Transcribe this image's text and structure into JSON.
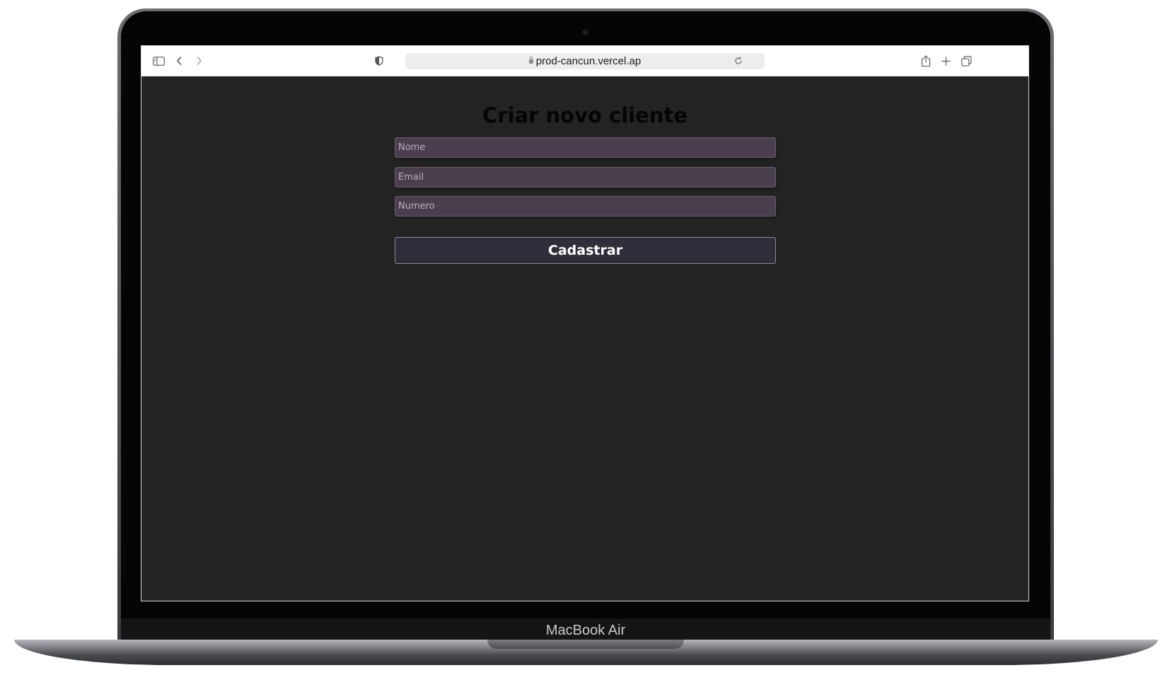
{
  "device": {
    "brand_label": "MacBook Air"
  },
  "browser": {
    "url": "prod-cancun.vercel.ap"
  },
  "page": {
    "title": "Criar novo cliente",
    "fields": {
      "name_placeholder": "Nome",
      "email_placeholder": "Email",
      "number_placeholder": "Numero"
    },
    "submit_label": "Cadastrar"
  },
  "colors": {
    "page_background": "#232323",
    "input_background": "#4b3f4f",
    "button_background": "#302e3a"
  },
  "icons": {
    "toolbar_left": [
      "sidebar-icon",
      "back-icon",
      "forward-icon"
    ],
    "address_bar": [
      "shield-icon",
      "lock-icon",
      "reload-icon"
    ],
    "toolbar_right": [
      "share-icon",
      "new-tab-icon",
      "tabs-overview-icon"
    ]
  }
}
